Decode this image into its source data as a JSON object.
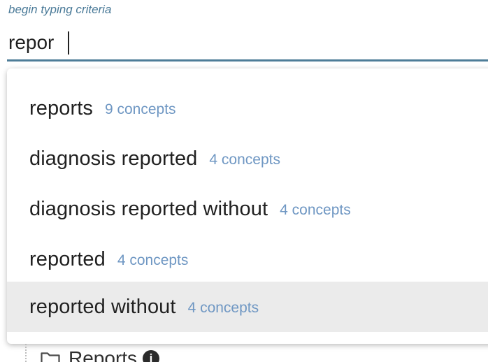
{
  "search": {
    "label": "begin typing criteria",
    "value": "repor"
  },
  "suggestions": [
    {
      "text": "reports",
      "count": "9 concepts",
      "active": false
    },
    {
      "text": "diagnosis reported",
      "count": "4 concepts",
      "active": false
    },
    {
      "text": "diagnosis reported without",
      "count": "4 concepts",
      "active": false
    },
    {
      "text": "reported",
      "count": "4 concepts",
      "active": false
    },
    {
      "text": "reported without",
      "count": "4 concepts",
      "active": true
    }
  ],
  "tree": {
    "folder_label": "Reports",
    "info_icon": "info-icon",
    "folder_icon": "folder-icon"
  },
  "colors": {
    "accent": "#4e7d98",
    "count": "#6f97c3",
    "active_row": "#ebebeb"
  }
}
